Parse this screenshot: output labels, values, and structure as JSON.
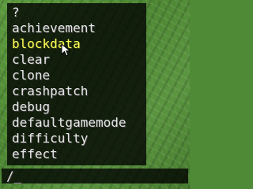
{
  "suggestions": [
    {
      "label": "?",
      "selected": false
    },
    {
      "label": "achievement",
      "selected": false
    },
    {
      "label": "blockdata",
      "selected": true
    },
    {
      "label": "clear",
      "selected": false
    },
    {
      "label": "clone",
      "selected": false
    },
    {
      "label": "crashpatch",
      "selected": false
    },
    {
      "label": "debug",
      "selected": false
    },
    {
      "label": "defaultgamemode",
      "selected": false
    },
    {
      "label": "difficulty",
      "selected": false
    },
    {
      "label": "effect",
      "selected": false
    }
  ],
  "chat": {
    "input_value": "/_"
  },
  "colors": {
    "selected_text": "#ffff55",
    "normal_text": "#e6e6e6",
    "background": "#4f8a36"
  },
  "icons": {
    "pointer": "mouse-pointer-icon"
  }
}
